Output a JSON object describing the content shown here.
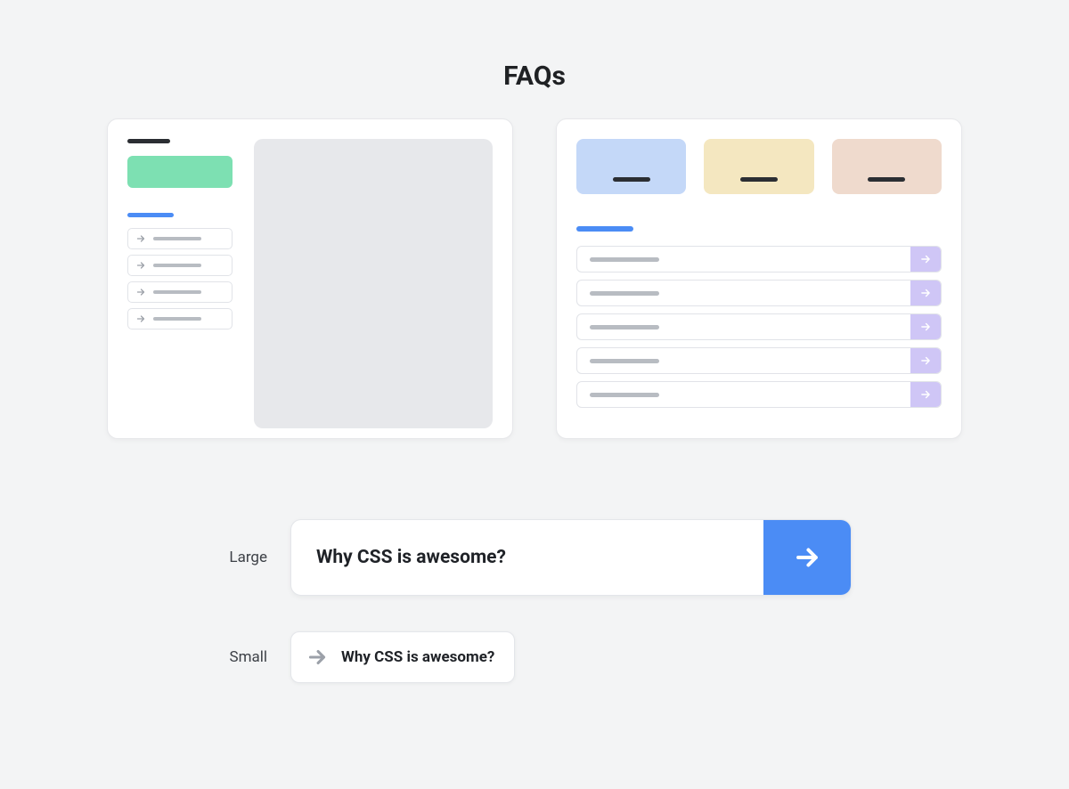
{
  "title": "FAQs",
  "examples": {
    "large": {
      "label": "Large",
      "question": "Why CSS is awesome?"
    },
    "small": {
      "label": "Small",
      "question": "Why CSS is awesome?"
    }
  },
  "colors": {
    "accent_blue": "#4b8cf5",
    "accent_green": "#7de0b2",
    "accent_purple": "#cfc6f6",
    "tab_blue": "#c4d8f8",
    "tab_yellow": "#f4e7c0",
    "tab_pink": "#efdacd"
  },
  "icons": {
    "arrow_right": "arrow-right-icon"
  }
}
